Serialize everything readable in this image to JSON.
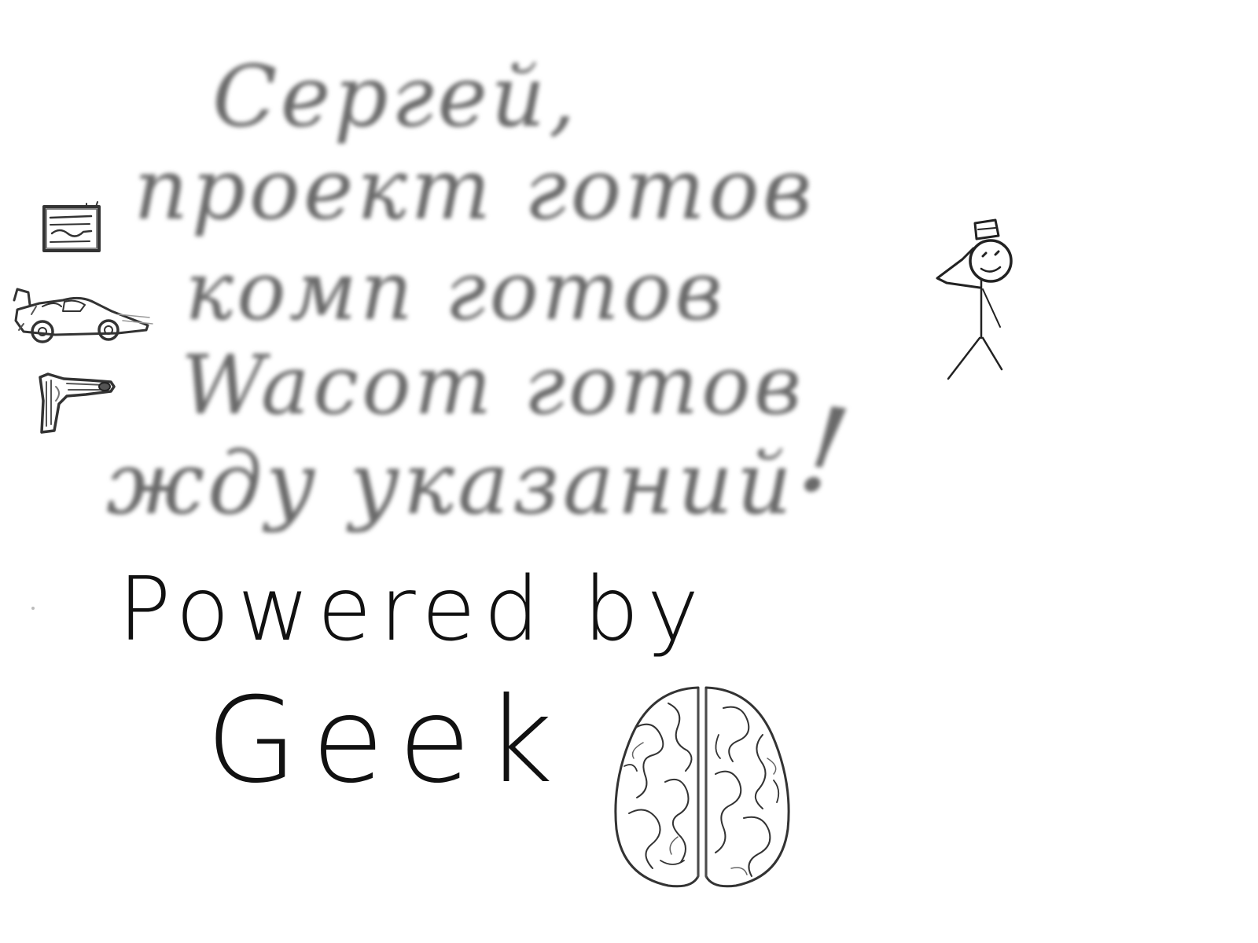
{
  "note": {
    "greeting": "Сергей,",
    "project_line": "проект готов",
    "computer_line": "комп готов",
    "wacom_line": "Wacom готов",
    "waiting_line": "жду указаний",
    "exclamation": "!"
  },
  "signature": {
    "powered_by": "Powered by",
    "name": "Geek"
  },
  "icons": {
    "document": "document-icon",
    "car": "race-car-icon",
    "pen": "stylus-pen-icon",
    "figure": "saluting-stick-figure",
    "brain": "brain-illustration"
  },
  "colors": {
    "background": "#ffffff",
    "blurred_ink": "#6a6a6a",
    "signature_ink": "#111111"
  }
}
